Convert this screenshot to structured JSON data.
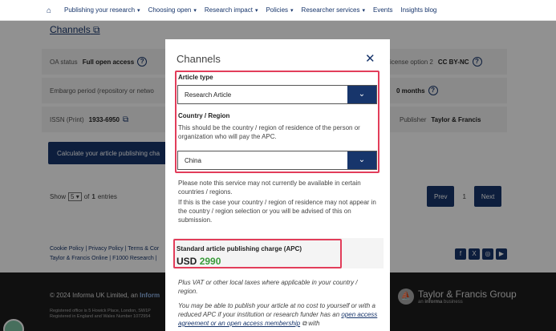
{
  "nav": {
    "items": [
      "Publishing your research",
      "Choosing open",
      "Research impact",
      "Policies",
      "Researcher services",
      "Events",
      "Insights blog"
    ]
  },
  "page": {
    "channels_link": "Channels",
    "oa_status_label": "OA status",
    "oa_status_value": "Full open access",
    "embargo_label": "Embargo period (repository or netwo",
    "issn_label": "ISSN (Print)",
    "issn_value": "1933-6950",
    "license_label": "icense option 2",
    "license_value": "CC BY-NC",
    "embargo_value": "0 months",
    "publisher_label": "Publisher",
    "publisher_value": "Taylor & Francis",
    "calc_button": "Calculate your article publishing cha",
    "show_label": "Show",
    "show_value": "5",
    "of_label": "of",
    "entries_count": "1",
    "entries_label": "entries",
    "prev": "Prev",
    "page_number": "1",
    "next": "Next"
  },
  "footer": {
    "links_line1": "Cookie Policy | Privacy Policy | Terms & Cor",
    "links_line2": "Taylor & Francis Online | F1000 Research |",
    "copyright_prefix": "© 2024 Informa UK Limited, an ",
    "copyright_link": "Inform",
    "registered_line1": "Registered office is 5 Howick Place, London, SW1P",
    "registered_line2": "Registered in England and Wales Number 1072954",
    "brand_name": "Taylor & Francis Group",
    "brand_sub_prefix": "an ",
    "brand_sub_bold": "informa",
    "brand_sub_suffix": " business"
  },
  "modal": {
    "title": "Channels",
    "article_type_label": "Article type",
    "article_type_value": "Research Article",
    "country_label": "Country / Region",
    "country_help": "This should be the country / region of residence of the person or organization who will pay the APC.",
    "country_value": "China",
    "note1": "Please note this service may not currently be available in certain countries / regions.",
    "note2": "If this is the case your country / region of residence may not appear in the country / region selection or you will be advised of this on submission.",
    "apc_label": "Standard article publishing charge (APC)",
    "apc_currency": "USD",
    "apc_amount": "2990",
    "vat_note": "Plus VAT or other local taxes where applicable in your country / region.",
    "waiver_note_prefix": "You may be able to publish your article at no cost to yourself or with a reduced APC if your institution or research funder has an ",
    "waiver_link": "open access agreement or an open access membership",
    "waiver_suffix": " with"
  },
  "colors": {
    "navy": "#17356b",
    "highlight": "#e23d5a",
    "price_green": "#3a9b3a"
  }
}
